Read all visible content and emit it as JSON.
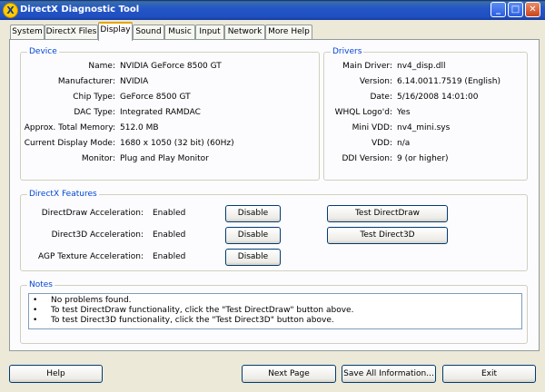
{
  "window": {
    "title": "DirectX Diagnostic Tool",
    "icon": "directx-x-icon",
    "controls": {
      "minimize": "_",
      "maximize": "□",
      "close": "✕"
    }
  },
  "tabs": [
    {
      "label": "System",
      "active": false
    },
    {
      "label": "DirectX Files",
      "active": false
    },
    {
      "label": "Display",
      "active": true
    },
    {
      "label": "Sound",
      "active": false
    },
    {
      "label": "Music",
      "active": false
    },
    {
      "label": "Input",
      "active": false
    },
    {
      "label": "Network",
      "active": false
    },
    {
      "label": "More Help",
      "active": false
    }
  ],
  "device": {
    "legend": "Device",
    "rows": [
      {
        "label": "Name:",
        "value": "NVIDIA GeForce 8500 GT"
      },
      {
        "label": "Manufacturer:",
        "value": "NVIDIA"
      },
      {
        "label": "Chip Type:",
        "value": "GeForce 8500 GT"
      },
      {
        "label": "DAC Type:",
        "value": "Integrated RAMDAC"
      },
      {
        "label": "Approx. Total Memory:",
        "value": "512.0 MB"
      },
      {
        "label": "Current Display Mode:",
        "value": "1680 x 1050 (32 bit) (60Hz)"
      },
      {
        "label": "Monitor:",
        "value": "Plug and Play Monitor"
      }
    ]
  },
  "drivers": {
    "legend": "Drivers",
    "rows": [
      {
        "label": "Main Driver:",
        "value": "nv4_disp.dll"
      },
      {
        "label": "Version:",
        "value": "6.14.0011.7519 (English)"
      },
      {
        "label": "Date:",
        "value": "5/16/2008 14:01:00"
      },
      {
        "label": "WHQL Logo'd:",
        "value": "Yes"
      },
      {
        "label": "Mini VDD:",
        "value": "nv4_mini.sys"
      },
      {
        "label": "VDD:",
        "value": "n/a"
      },
      {
        "label": "DDI Version:",
        "value": "9 (or higher)"
      }
    ]
  },
  "features": {
    "legend": "DirectX Features",
    "rows": [
      {
        "label": "DirectDraw Acceleration:",
        "value": "Enabled",
        "button": "Disable",
        "test": "Test DirectDraw"
      },
      {
        "label": "Direct3D Acceleration:",
        "value": "Enabled",
        "button": "Disable",
        "test": "Test Direct3D"
      },
      {
        "label": "AGP Texture Acceleration:",
        "value": "Enabled",
        "button": "Disable",
        "test": ""
      }
    ]
  },
  "notes": {
    "legend": "Notes",
    "bullet": "•",
    "lines": [
      "No problems found.",
      "To test DirectDraw functionality, click the \"Test DirectDraw\" button above.",
      "To test Direct3D functionality, click the \"Test Direct3D\" button above."
    ]
  },
  "footer": {
    "help": "Help",
    "next_page": "Next Page",
    "save_all": "Save All Information...",
    "exit": "Exit"
  }
}
